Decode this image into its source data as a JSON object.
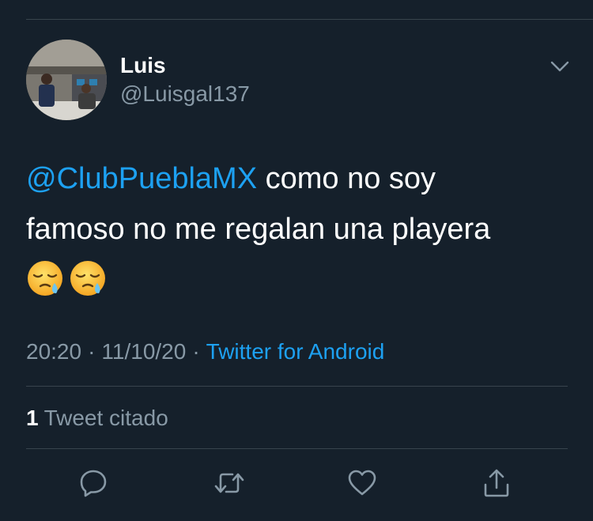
{
  "tweet": {
    "author": {
      "name": "Luis",
      "handle": "@Luisgal137"
    },
    "text": {
      "mention": "@ClubPueblaMX",
      "line1_rest": " como no soy",
      "line2": "famoso no me regalan una playera",
      "emojis": [
        "sleepy-face-emoji",
        "sleepy-face-emoji"
      ]
    },
    "meta": {
      "time": "20:20",
      "separator": "·",
      "date": "11/10/20",
      "source": "Twitter for Android"
    },
    "quotes": {
      "count": "1",
      "label": "Tweet citado"
    },
    "actions": {
      "reply_icon": "reply-icon",
      "retweet_icon": "retweet-icon",
      "like_icon": "like-icon",
      "share_icon": "share-icon"
    }
  },
  "colors": {
    "background": "#15202b",
    "text": "#ffffff",
    "secondary_text": "#8899a6",
    "accent": "#1da1f2",
    "divider": "#38444d"
  }
}
